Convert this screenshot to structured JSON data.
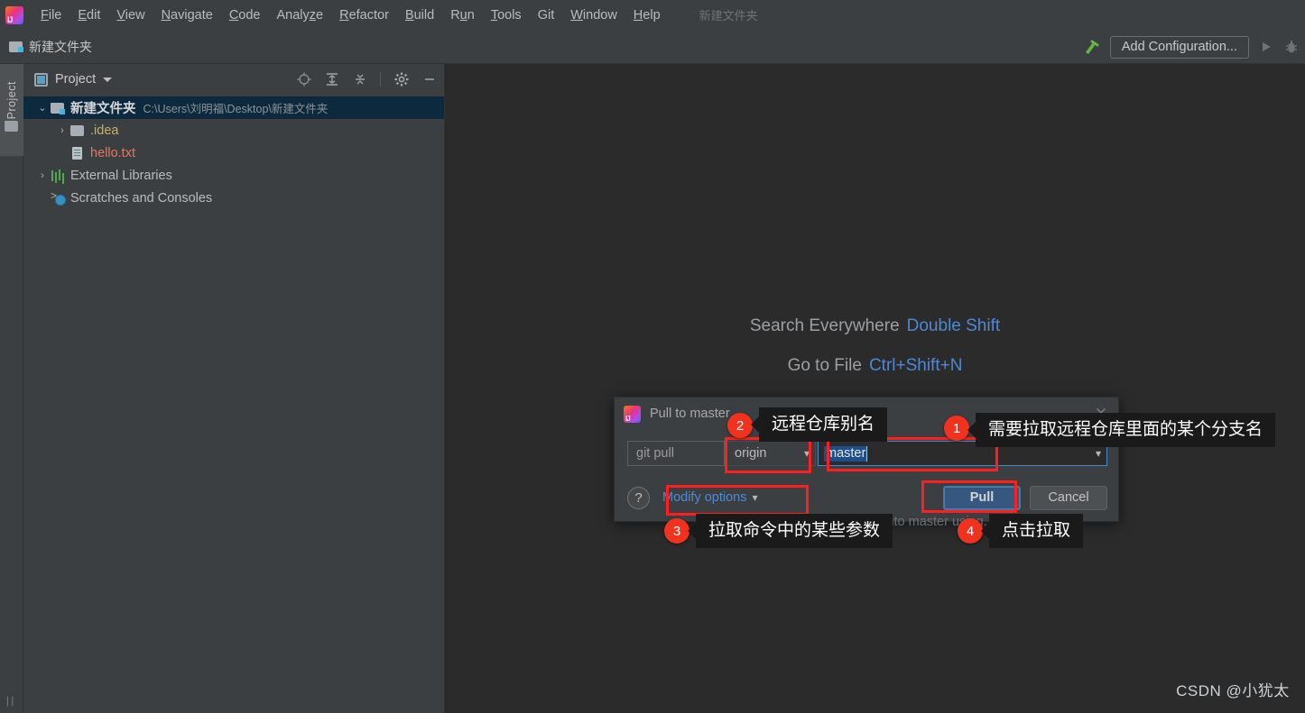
{
  "menubar": {
    "logo": "intellij-idea-logo",
    "items": [
      {
        "label": "File",
        "mnemonic": "F"
      },
      {
        "label": "Edit",
        "mnemonic": "E"
      },
      {
        "label": "View",
        "mnemonic": "V"
      },
      {
        "label": "Navigate",
        "mnemonic": "N"
      },
      {
        "label": "Code",
        "mnemonic": "C"
      },
      {
        "label": "Analyze",
        "mnemonic": "z"
      },
      {
        "label": "Refactor",
        "mnemonic": "R"
      },
      {
        "label": "Build",
        "mnemonic": "B"
      },
      {
        "label": "Run",
        "mnemonic": "u"
      },
      {
        "label": "Tools",
        "mnemonic": "T"
      },
      {
        "label": "Git",
        "mnemonic": ""
      },
      {
        "label": "Window",
        "mnemonic": "W"
      },
      {
        "label": "Help",
        "mnemonic": "H"
      }
    ],
    "project_name": "新建文件夹"
  },
  "navbar": {
    "breadcrumb": "新建文件夹",
    "hammer_icon": "build-hammer-icon",
    "add_configuration_label": "Add Configuration...",
    "run_icon": "run-play-icon",
    "debug_icon": "debug-bug-icon"
  },
  "left_stripe": {
    "project_tab_label": "Project",
    "folder_icon": "folder-icon",
    "bottom_icon": "terminal-icon"
  },
  "project_panel": {
    "title": "Project",
    "tools": [
      {
        "name": "locate-icon",
        "glyph": "⊕"
      },
      {
        "name": "expand-all-icon",
        "glyph": "↧"
      },
      {
        "name": "collapse-all-icon",
        "glyph": "↥"
      },
      {
        "name": "settings-gear-icon",
        "glyph": "⚙"
      },
      {
        "name": "hide-panel-icon",
        "glyph": "−"
      }
    ],
    "tree": [
      {
        "label": "新建文件夹",
        "path": "C:\\Users\\刘明福\\Desktop\\新建文件夹",
        "icon": "folder-module-icon",
        "indent": 0,
        "twist": "⌄",
        "selected": true,
        "bold": true,
        "color": "#d6d6d6"
      },
      {
        "label": ".idea",
        "path": "",
        "icon": "folder-icon",
        "indent": 1,
        "twist": "›",
        "selected": false,
        "bold": false,
        "color": "#c9b06a"
      },
      {
        "label": "hello.txt",
        "path": "",
        "icon": "file-text-icon",
        "indent": 1,
        "twist": "",
        "selected": false,
        "bold": false,
        "color": "#e07a5f"
      },
      {
        "label": "External Libraries",
        "path": "",
        "icon": "libraries-icon",
        "indent": 0,
        "twist": "›",
        "selected": false,
        "bold": false,
        "color": "#bbbbbb"
      },
      {
        "label": "Scratches and Consoles",
        "path": "",
        "icon": "scratches-icon",
        "indent": 0,
        "twist": "",
        "selected": false,
        "bold": false,
        "color": "#bbbbbb"
      }
    ]
  },
  "editor": {
    "hints": [
      {
        "action": "Search Everywhere",
        "shortcut": "Double Shift"
      },
      {
        "action": "Go to File",
        "shortcut": "Ctrl+Shift+N"
      }
    ],
    "watermark": "CSDN @小犹太 "
  },
  "dialog": {
    "title": "Pull to master",
    "icon": "intellij-idea-logo",
    "close_icon": "close-icon",
    "command_label": "git pull",
    "remote_value": "origin",
    "branch_value": "master",
    "help_icon": "help-question-icon",
    "modify_options_label": "Modify options",
    "modify_options_chevron": "chevron-down-icon",
    "pull_button": "Pull",
    "cancel_button": "Cancel",
    "obscured_text": "Pull into master using..."
  },
  "annotations": [
    {
      "number": "1",
      "text": "需要拉取远程仓库里面的某个分支名"
    },
    {
      "number": "2",
      "text": "远程仓库别名"
    },
    {
      "number": "3",
      "text": "拉取命令中的某些参数"
    },
    {
      "number": "4",
      "text": "点击拉取"
    }
  ],
  "colors": {
    "accent_blue": "#4d89d4",
    "annotation_red": "#ff1f1f",
    "badge_red": "#f0321e",
    "panel_bg": "#3c3f41",
    "editor_bg": "#2b2b2b",
    "selection_blue": "#0d293e"
  }
}
